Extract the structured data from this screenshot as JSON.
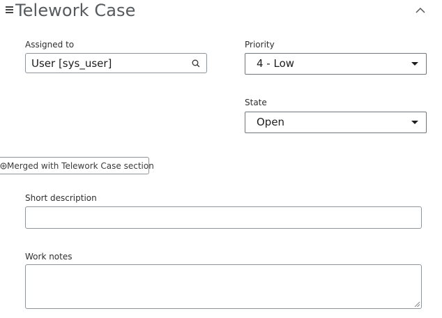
{
  "section": {
    "title": "Telework Case",
    "menu_icon": "hamburger-menu-icon",
    "collapse_icon": "chevron-up-icon"
  },
  "fields": {
    "assigned_to": {
      "label": "Assigned to",
      "value": "User [sys_user]",
      "icon": "search-icon"
    },
    "priority": {
      "label": "Priority",
      "value": "4 - Low"
    },
    "state": {
      "label": "State",
      "value": "Open"
    },
    "merged_button": {
      "label": "Merged with Telework Case section",
      "icon": "merge-icon"
    },
    "short_description": {
      "label": "Short description",
      "value": ""
    },
    "work_notes": {
      "label": "Work notes",
      "value": ""
    }
  },
  "colors": {
    "title_text": "#555a5e",
    "border": "#8e9499",
    "text": "#2e2e2e"
  }
}
